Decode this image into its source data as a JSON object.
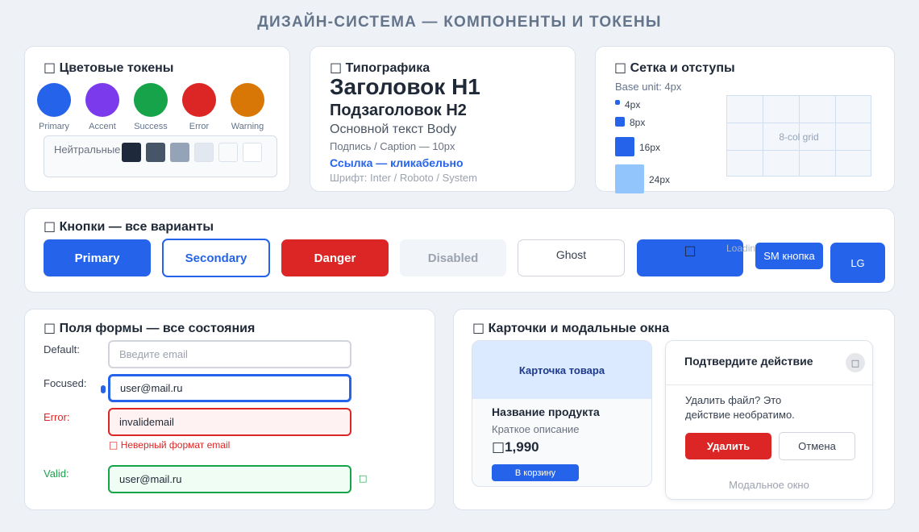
{
  "page_title": "ДИЗАЙН-СИСТЕМА — КОМПОНЕНТЫ И ТОКЕНЫ",
  "colors": {
    "title": "Цветовые токены",
    "title_icon": "□",
    "swatches": [
      {
        "label": "Primary",
        "color": "#2563eb"
      },
      {
        "label": "Accent",
        "color": "#7c3aed"
      },
      {
        "label": "Success",
        "color": "#16a34a"
      },
      {
        "label": "Error",
        "color": "#dc2626"
      },
      {
        "label": "Warning",
        "color": "#d97706"
      }
    ],
    "neutral_label": "Нейтральные",
    "neutrals": [
      "#1e293b",
      "#475569",
      "#94a3b8",
      "#e2e8f0",
      "#f8fafc",
      "#ffffff"
    ]
  },
  "typography": {
    "title": "Типографика",
    "title_icon": "□",
    "h1": "Заголовок H1",
    "h2": "Подзаголовок H2",
    "body": "Основной текст Body",
    "caption": "Подпись / Caption — 10px",
    "link": "Ссылка — кликабельно",
    "font": "Шрифт: Inter / Roboto / System"
  },
  "spacing": {
    "title": "Сетка и отступы",
    "title_icon": "□",
    "base": "Base unit: 4px",
    "sizes": [
      "4px",
      "8px",
      "16px",
      "24px"
    ],
    "grid_label": "8-col grid"
  },
  "buttons": {
    "title": "Кнопки — все варианты",
    "title_icon": "□",
    "primary": "Primary",
    "secondary": "Secondary",
    "danger": "Danger",
    "disabled": "Disabled",
    "ghost": "Ghost",
    "loading_icon": "□",
    "loading_text": "Loading",
    "sm": "SM кнопка",
    "lg": "LG"
  },
  "form": {
    "title": "Поля формы — все состояния",
    "title_icon": "□",
    "default_label": "Default:",
    "default_placeholder": "Введите email",
    "focused_label": "Focused:",
    "focused_value": "user@mail.ru",
    "error_label": "Error:",
    "error_value": "invalidemail",
    "error_icon": "□",
    "error_message": "Неверный формат email",
    "valid_label": "Valid:",
    "valid_value": "user@mail.ru",
    "valid_icon": "□"
  },
  "cards": {
    "title": "Карточки и модальные окна",
    "title_icon": "□",
    "product": {
      "header": "Карточка товара",
      "name": "Название продукта",
      "desc": "Краткое описание",
      "currency": "□",
      "price": "1,990",
      "cta": "В корзину"
    },
    "modal": {
      "title": "Подтвердите действие",
      "close_icon": "□",
      "line1": "Удалить файл? Это",
      "line2": "действие необратимо.",
      "confirm": "Удалить",
      "cancel": "Отмена",
      "footer": "Модальное окно"
    }
  }
}
